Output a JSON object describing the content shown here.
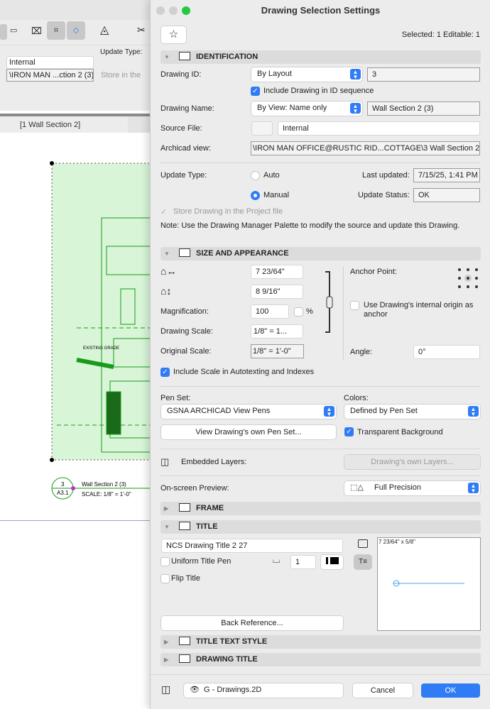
{
  "background": {
    "source_file": "Internal",
    "archicad_view": "\\IRON MAN ...ction 2 (3)",
    "update_type_label": "Update Type:",
    "store_label": "Store in the",
    "tab_label": "[1 Wall Section 2]",
    "drawing_text_grade": "EXISTING GRADE",
    "marker_number": "3",
    "marker_sheet": "A3.1",
    "marker_title": "Wall Section 2 (3)",
    "marker_scale": "SCALE: 1/8\"  =  1'-0\""
  },
  "dialog": {
    "title": "Drawing Selection Settings",
    "selected_info": "Selected: 1 Editable: 1",
    "identification": {
      "header": "IDENTIFICATION",
      "drawing_id_label": "Drawing ID:",
      "drawing_id_mode": "By Layout",
      "drawing_id_value": "3",
      "include_in_sequence": "Include Drawing in ID sequence",
      "drawing_name_label": "Drawing Name:",
      "drawing_name_mode": "By View: Name only",
      "drawing_name_value": "Wall Section 2 (3)",
      "source_file_label": "Source File:",
      "source_file_value": "Internal",
      "archicad_view_label": "Archicad view:",
      "archicad_view_value": "\\IRON MAN OFFICE@RUSTIC RID...COTTAGE\\3 Wall Section 2 (3)",
      "update_type_label": "Update Type:",
      "auto_label": "Auto",
      "manual_label": "Manual",
      "last_updated_label": "Last updated:",
      "last_updated_value": "7/15/25, 1:41 PM",
      "update_status_label": "Update Status:",
      "update_status_value": "OK",
      "store_drawing": "Store Drawing in the Project file",
      "note": "Note: Use the Drawing Manager Palette to modify the source and update this Drawing."
    },
    "size": {
      "header": "SIZE AND APPEARANCE",
      "width_value": "7 23/64\"",
      "height_value": "8 9/16\"",
      "magnification_label": "Magnification:",
      "magnification_value": "100",
      "percent": "%",
      "drawing_scale_label": "Drawing Scale:",
      "drawing_scale_value": "1/8\"   =    1...",
      "original_scale_label": "Original Scale:",
      "original_scale_value": "1/8\"   =    1'-0\"",
      "anchor_label": "Anchor Point:",
      "use_origin": "Use Drawing's internal origin as anchor",
      "angle_label": "Angle:",
      "angle_value": "0°",
      "include_scale": "Include Scale in Autotexting and Indexes",
      "pen_set_label": "Pen Set:",
      "pen_set_value": "GSNA ARCHICAD View Pens",
      "colors_label": "Colors:",
      "colors_value": "Defined by Pen Set",
      "view_pen_set": "View Drawing's own Pen Set...",
      "transparent_bg": "Transparent Background",
      "embedded_layers_label": "Embedded Layers:",
      "own_layers": "Drawing's own Layers...",
      "preview_label": "On-screen Preview:",
      "preview_value": "Full Precision"
    },
    "frame": {
      "header": "FRAME"
    },
    "title_section": {
      "header": "TITLE",
      "title_type": "NCS Drawing Title 2 27",
      "uniform_pen": "Uniform Title Pen",
      "pen_value": "1",
      "flip_title": "Flip Title",
      "preview_size": "7 23/64\" x 5/8\"",
      "back_reference": "Back Reference..."
    },
    "title_text_style": {
      "header": "TITLE TEXT STYLE"
    },
    "drawing_title": {
      "header": "DRAWING TITLE"
    },
    "footer": {
      "layer": "G - Drawings.2D",
      "cancel": "Cancel",
      "ok": "OK"
    },
    "colors": {
      "accent": "#2f7cf6",
      "drawing_green": "#1a9a1a"
    }
  }
}
